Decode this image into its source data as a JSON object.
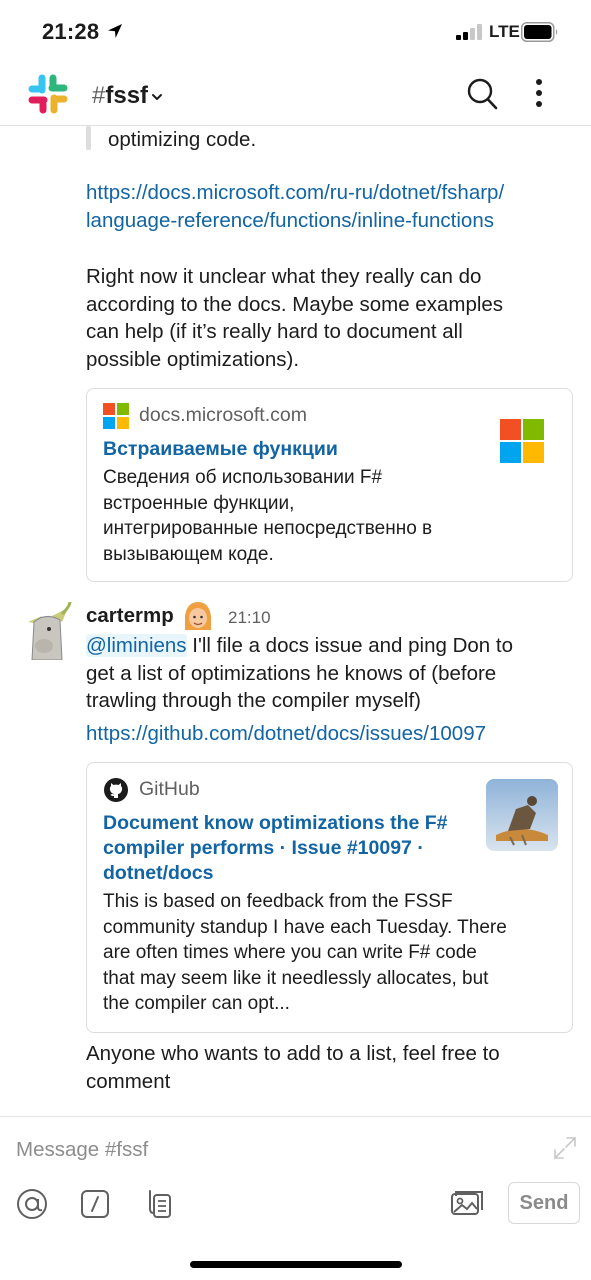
{
  "status_bar": {
    "time": "21:28",
    "network": "LTE"
  },
  "header": {
    "channel_prefix": "#",
    "channel_name": "fssf",
    "icons": [
      "slack-logo",
      "chevron-down-icon",
      "search-icon",
      "more-vertical-icon"
    ]
  },
  "messages": {
    "quote_tail": "optimizing code.",
    "inline_link": "https://docs.microsoft.com/ru-ru/dotnet/fsharp/language-reference/functions/inline-functions",
    "inline_link_lines": [
      "https://docs.microsoft.com/ru-ru/dotnet/fsharp/",
      "language-reference/functions/inline-functions"
    ],
    "body_lines": [
      "Right now it unclear what they really can do",
      "according to the docs. Maybe some examples",
      "can help (if it’s really hard to document all",
      "possible optimizations)."
    ],
    "unfurl_1": {
      "site": "docs.microsoft.com",
      "title": "Встраиваемые функции",
      "desc_lines": [
        "Сведения об использовании F#",
        "встроенные функции,",
        "интегрированные непосредственно в",
        "вызывающем коде."
      ]
    },
    "second": {
      "author": "cartermp",
      "time": "21:10",
      "mention": "@liminiens",
      "line1_rest": " I'll file a docs issue and ping Don to",
      "line2": "get a list of optimizations he knows of (before",
      "line3": "trawling through the compiler myself)",
      "link": "https://github.com/dotnet/docs/issues/10097",
      "unfurl": {
        "site": "GitHub",
        "title_lines": [
          "Document know optimizations the F#",
          "compiler performs · Issue #10097 ·",
          "dotnet/docs"
        ],
        "desc_lines": [
          "This is based on feedback from the FSSF",
          "community standup I have each Tuesday. There",
          "are often times where you can write F# code",
          "that may seem like it needlessly allocates, but",
          "the compiler can opt..."
        ]
      },
      "followup_lines": [
        "Anyone who wants to add to a list, feel free to",
        "comment"
      ]
    }
  },
  "composer": {
    "placeholder": "Message #fssf",
    "send_label": "Send",
    "icons": [
      "at-icon",
      "slash-command-icon",
      "attach-file-icon",
      "photo-icon",
      "expand-icon"
    ]
  },
  "colors": {
    "link": "#1264a3",
    "text": "#1d1c1d",
    "muted": "#616061",
    "border": "#dddddd"
  }
}
